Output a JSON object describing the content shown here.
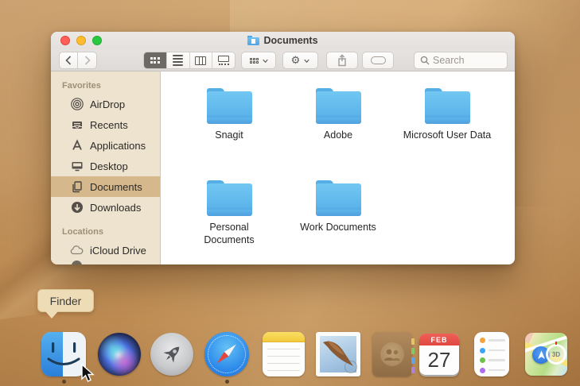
{
  "colors": {
    "wallpaper_tan": "#c89a63",
    "sidebar_bg": "#ede3cf",
    "sidebar_selected": "#d5b98d",
    "folder_blue": "#5cb4ea",
    "traffic_red": "#ff5f57",
    "traffic_yellow": "#febc2e",
    "traffic_green": "#28c840",
    "selected_segment": "#6d6a66",
    "tooltip_bg": "#eedcb6"
  },
  "window": {
    "title": "Documents",
    "toolbar": {
      "search_placeholder": "Search",
      "view_modes": [
        "icon-view",
        "list-view",
        "column-view",
        "gallery-view"
      ],
      "selected_view": "icon-view"
    },
    "sidebar": {
      "sections": [
        {
          "label": "Favorites",
          "items": [
            {
              "label": "AirDrop",
              "icon": "airdrop-icon",
              "selected": false
            },
            {
              "label": "Recents",
              "icon": "recents-icon",
              "selected": false
            },
            {
              "label": "Applications",
              "icon": "applications-icon",
              "selected": false
            },
            {
              "label": "Desktop",
              "icon": "desktop-icon",
              "selected": false
            },
            {
              "label": "Documents",
              "icon": "documents-icon",
              "selected": true
            },
            {
              "label": "Downloads",
              "icon": "downloads-icon",
              "selected": false
            }
          ]
        },
        {
          "label": "Locations",
          "items": [
            {
              "label": "iCloud Drive",
              "icon": "icloud-icon",
              "selected": false
            }
          ]
        }
      ]
    },
    "folders": [
      {
        "name": "Snagit"
      },
      {
        "name": "Adobe"
      },
      {
        "name": "Microsoft User Data"
      },
      {
        "name": "Personal Documents"
      },
      {
        "name": "Work Documents"
      }
    ]
  },
  "tooltip": {
    "label": "Finder"
  },
  "dock": {
    "items": [
      {
        "name": "Finder",
        "running": true
      },
      {
        "name": "Siri",
        "running": false
      },
      {
        "name": "Launchpad",
        "running": false
      },
      {
        "name": "Safari",
        "running": true
      },
      {
        "name": "Notes",
        "running": false
      },
      {
        "name": "Mail",
        "running": false
      },
      {
        "name": "Contacts",
        "running": false
      },
      {
        "name": "Calendar",
        "running": false,
        "month": "FEB",
        "day": "27"
      },
      {
        "name": "Reminders",
        "running": false
      },
      {
        "name": "Maps",
        "running": false,
        "badge": "3D"
      }
    ]
  }
}
